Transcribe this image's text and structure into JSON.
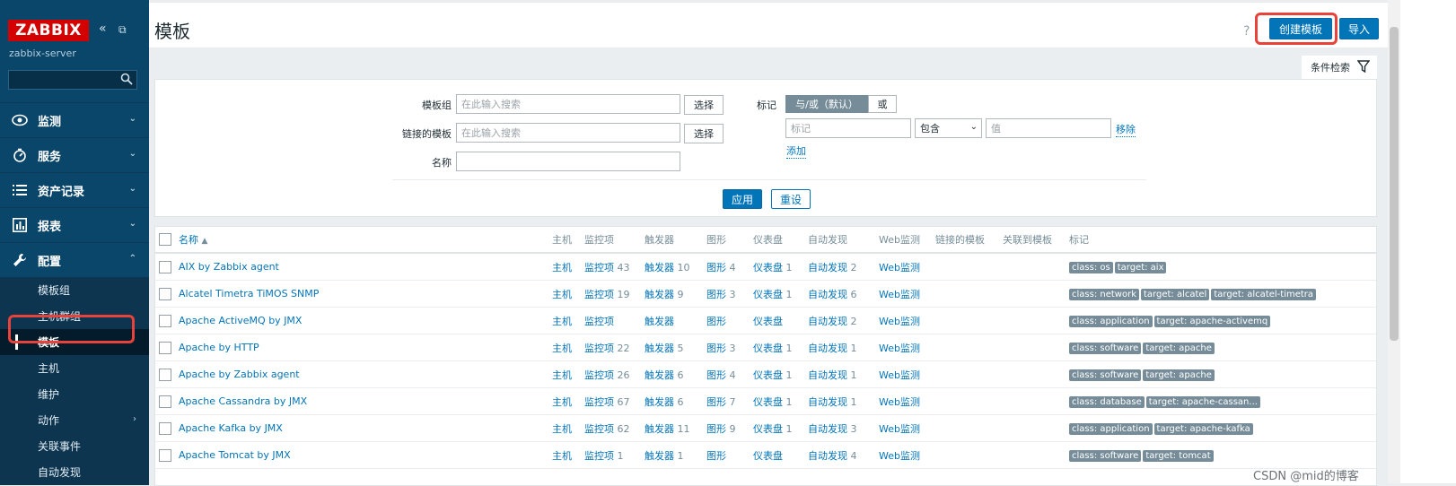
{
  "sidebar": {
    "logo": "ZABBIX",
    "server": "zabbix-server",
    "menu": [
      {
        "label": "监测"
      },
      {
        "label": "服务"
      },
      {
        "label": "资产记录"
      },
      {
        "label": "报表"
      },
      {
        "label": "配置"
      }
    ],
    "submenu": [
      {
        "label": "模板组"
      },
      {
        "label": "主机群组"
      },
      {
        "label": "模板"
      },
      {
        "label": "主机"
      },
      {
        "label": "维护"
      },
      {
        "label": "动作"
      },
      {
        "label": "关联事件"
      },
      {
        "label": "自动发现"
      }
    ]
  },
  "header": {
    "title": "模板",
    "create_button": "创建模板",
    "import_button": "导入",
    "help": "?"
  },
  "filter": {
    "tab_label": "条件检索",
    "template_group_label": "模板组",
    "linked_template_label": "链接的模板",
    "name_label": "名称",
    "search_placeholder": "在此输入搜索",
    "select_button": "选择",
    "tags_label": "标记",
    "and_or": "与/或（默认）",
    "or": "或",
    "tag_placeholder": "标记",
    "operator": "包含",
    "value_placeholder": "值",
    "remove": "移除",
    "add": "添加",
    "apply": "应用",
    "reset": "重设"
  },
  "table": {
    "headers": {
      "name": "名称",
      "hosts": "主机",
      "items": "监控项",
      "triggers": "触发器",
      "graphs": "图形",
      "dashboards": "仪表盘",
      "discovery": "自动发现",
      "web": "Web监测",
      "linked": "链接的模板",
      "linked_to": "关联到模板",
      "tags": "标记"
    },
    "rows": [
      {
        "name": "AIX by Zabbix agent",
        "hosts": "主机",
        "items": "监控项",
        "items_n": "43",
        "triggers": "触发器",
        "triggers_n": "10",
        "graphs": "图形",
        "graphs_n": "4",
        "dash": "仪表盘",
        "dash_n": "1",
        "disc": "自动发现",
        "disc_n": "2",
        "web": "Web监测",
        "tags": [
          "class: os",
          "target: aix"
        ]
      },
      {
        "name": "Alcatel Timetra TiMOS SNMP",
        "hosts": "主机",
        "items": "监控项",
        "items_n": "19",
        "triggers": "触发器",
        "triggers_n": "9",
        "graphs": "图形",
        "graphs_n": "3",
        "dash": "仪表盘",
        "dash_n": "1",
        "disc": "自动发现",
        "disc_n": "6",
        "web": "Web监测",
        "tags": [
          "class: network",
          "target: alcatel",
          "target: alcatel-timetra"
        ]
      },
      {
        "name": "Apache ActiveMQ by JMX",
        "hosts": "主机",
        "items": "监控项",
        "items_n": "",
        "triggers": "触发器",
        "triggers_n": "",
        "graphs": "图形",
        "graphs_n": "",
        "dash": "仪表盘",
        "dash_n": "",
        "disc": "自动发现",
        "disc_n": "2",
        "web": "Web监测",
        "tags": [
          "class: application",
          "target: apache-activemq"
        ]
      },
      {
        "name": "Apache by HTTP",
        "hosts": "主机",
        "items": "监控项",
        "items_n": "22",
        "triggers": "触发器",
        "triggers_n": "5",
        "graphs": "图形",
        "graphs_n": "3",
        "dash": "仪表盘",
        "dash_n": "1",
        "disc": "自动发现",
        "disc_n": "1",
        "web": "Web监测",
        "tags": [
          "class: software",
          "target: apache"
        ]
      },
      {
        "name": "Apache by Zabbix agent",
        "hosts": "主机",
        "items": "监控项",
        "items_n": "26",
        "triggers": "触发器",
        "triggers_n": "6",
        "graphs": "图形",
        "graphs_n": "4",
        "dash": "仪表盘",
        "dash_n": "1",
        "disc": "自动发现",
        "disc_n": "1",
        "web": "Web监测",
        "tags": [
          "class: software",
          "target: apache"
        ]
      },
      {
        "name": "Apache Cassandra by JMX",
        "hosts": "主机",
        "items": "监控项",
        "items_n": "67",
        "triggers": "触发器",
        "triggers_n": "6",
        "graphs": "图形",
        "graphs_n": "7",
        "dash": "仪表盘",
        "dash_n": "1",
        "disc": "自动发现",
        "disc_n": "1",
        "web": "Web监测",
        "tags": [
          "class: database",
          "target: apache-cassan..."
        ]
      },
      {
        "name": "Apache Kafka by JMX",
        "hosts": "主机",
        "items": "监控项",
        "items_n": "62",
        "triggers": "触发器",
        "triggers_n": "11",
        "graphs": "图形",
        "graphs_n": "9",
        "dash": "仪表盘",
        "dash_n": "1",
        "disc": "自动发现",
        "disc_n": "3",
        "web": "Web监测",
        "tags": [
          "class: application",
          "target: apache-kafka"
        ]
      },
      {
        "name": "Apache Tomcat by JMX",
        "hosts": "主机",
        "items": "监控项",
        "items_n": "1",
        "triggers": "触发器",
        "triggers_n": "1",
        "graphs": "图形",
        "graphs_n": "",
        "dash": "仪表盘",
        "dash_n": "",
        "disc": "自动发现",
        "disc_n": "4",
        "web": "Web监测",
        "tags": [
          "class: software",
          "target: tomcat"
        ]
      }
    ]
  },
  "watermark": "CSDN @mid的博客"
}
